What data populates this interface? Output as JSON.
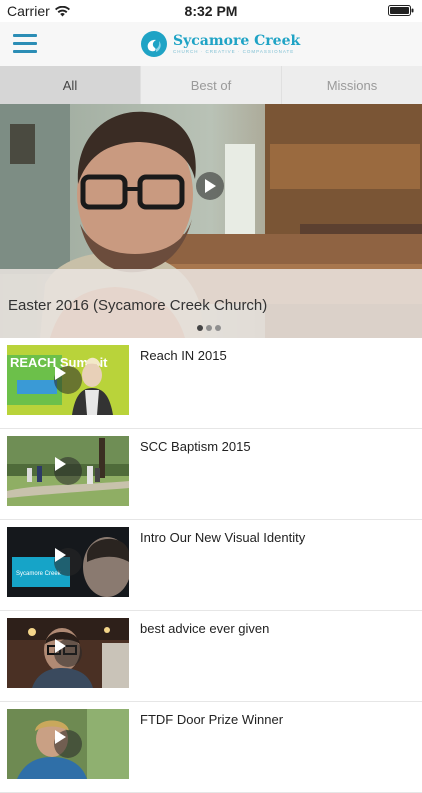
{
  "status": {
    "carrier": "Carrier",
    "time": "8:32 PM"
  },
  "header": {
    "logo_name": "Sycamore Creek",
    "logo_tagline": "CHURCH · CREATIVE · COMPASSIONATE"
  },
  "tabs": [
    {
      "label": "All",
      "active": true
    },
    {
      "label": "Best of",
      "active": false
    },
    {
      "label": "Missions",
      "active": false
    }
  ],
  "featured": {
    "title": "Easter 2016 (Sycamore Creek Church)",
    "page": 1,
    "pages": 3
  },
  "videos": [
    {
      "title": "Reach IN 2015",
      "thumb_text": "REACH Summit"
    },
    {
      "title": "SCC Baptism 2015"
    },
    {
      "title": "Intro Our New Visual Identity",
      "thumb_text": "Sycamore Creek"
    },
    {
      "title": "best advice ever given"
    },
    {
      "title": "FTDF Door Prize Winner"
    }
  ],
  "colors": {
    "accent": "#2b8db5",
    "logo": "#1fa3c5"
  }
}
